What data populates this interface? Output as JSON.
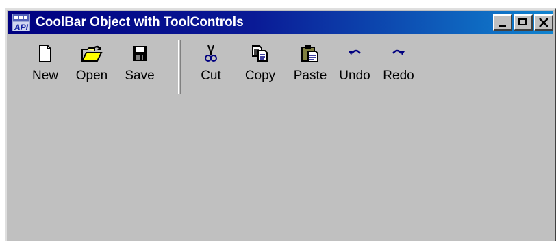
{
  "window": {
    "title": "CoolBar Object with ToolControls",
    "app_icon_text": "API"
  },
  "toolbar_file": {
    "buttons": [
      {
        "label": "New",
        "icon": "new-file-icon"
      },
      {
        "label": "Open",
        "icon": "open-folder-icon"
      },
      {
        "label": "Save",
        "icon": "save-disk-icon"
      }
    ]
  },
  "toolbar_edit": {
    "buttons": [
      {
        "label": "Cut",
        "icon": "scissors-icon"
      },
      {
        "label": "Copy",
        "icon": "copy-icon"
      },
      {
        "label": "Paste",
        "icon": "paste-clipboard-icon"
      },
      {
        "label": "Undo",
        "icon": "undo-arrow-icon"
      },
      {
        "label": "Redo",
        "icon": "redo-arrow-icon"
      }
    ]
  },
  "colors": {
    "titlebar_start": "#000080",
    "titlebar_end": "#1084d0",
    "face": "#c0c0c0",
    "icon_blue": "#000080"
  }
}
